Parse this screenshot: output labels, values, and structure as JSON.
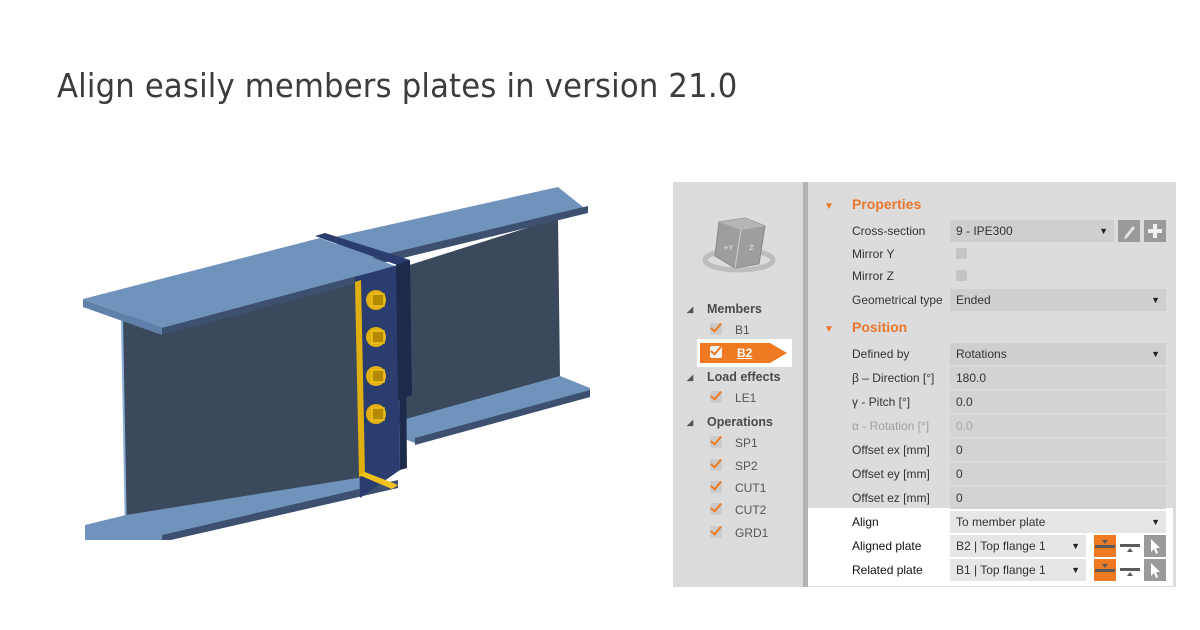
{
  "headline": "Align easily members plates in version 21.0",
  "model": {
    "description": "I-beam splice connection 3D view",
    "colors": {
      "flange": "#7093bb",
      "web": "#3a4a5c",
      "end_plate": "#2a3d6e",
      "weld_bolt": "#f2c21b"
    },
    "bolt_count": 4
  },
  "tree": {
    "navcube_labels": [
      "+Y",
      "Z"
    ],
    "groups": [
      {
        "label": "Members",
        "items": [
          {
            "label": "B1",
            "checked": true
          },
          {
            "label": "B2",
            "checked": true,
            "selected": true
          }
        ]
      },
      {
        "label": "Load effects",
        "items": [
          {
            "label": "LE1",
            "checked": true
          }
        ]
      },
      {
        "label": "Operations",
        "items": [
          {
            "label": "SP1",
            "checked": true
          },
          {
            "label": "SP2",
            "checked": true
          },
          {
            "label": "CUT1",
            "checked": true
          },
          {
            "label": "CUT2",
            "checked": true
          },
          {
            "label": "GRD1",
            "checked": true
          }
        ]
      }
    ]
  },
  "properties": {
    "title": "Properties",
    "cross_section": {
      "label": "Cross-section",
      "value": "9 - IPE300"
    },
    "mirror_y": {
      "label": "Mirror Y",
      "checked": false
    },
    "mirror_z": {
      "label": "Mirror Z",
      "checked": false
    },
    "geometrical_type": {
      "label": "Geometrical type",
      "value": "Ended"
    }
  },
  "position": {
    "title": "Position",
    "defined_by": {
      "label": "Defined by",
      "value": "Rotations"
    },
    "direction": {
      "label": "β – Direction [°]",
      "value": "180.0"
    },
    "pitch": {
      "label": "γ - Pitch [°]",
      "value": "0.0"
    },
    "rotation": {
      "label": "α - Rotation [°]",
      "value": "0.0"
    },
    "offset_ex": {
      "label": "Offset ex [mm]",
      "value": "0"
    },
    "offset_ey": {
      "label": "Offset ey [mm]",
      "value": "0"
    },
    "offset_ez": {
      "label": "Offset ez [mm]",
      "value": "0"
    },
    "align": {
      "label": "Align",
      "value": "To member plate"
    },
    "aligned_plate": {
      "label": "Aligned plate",
      "value": "B2 | Top flange 1"
    },
    "related_plate": {
      "label": "Related plate",
      "value": "B1 | Top flange 1"
    }
  },
  "icons": {
    "dropdown": "▼",
    "expand": "◢",
    "section_expand": "▼"
  },
  "colors": {
    "accent": "#f07a22",
    "panel_bg": "#dcdcdc",
    "field_bg": "#cfcfcf",
    "headline": "#3c3c3c"
  }
}
